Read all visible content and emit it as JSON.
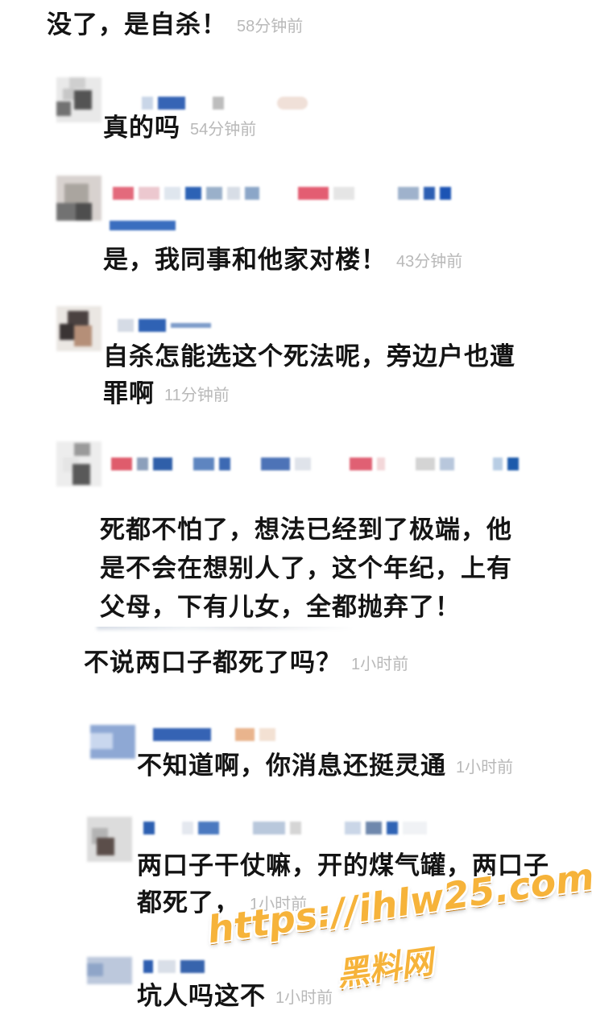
{
  "comments": [
    {
      "text": "没了，是自杀！",
      "time": "58分钟前"
    },
    {
      "text": "真的吗",
      "time": "54分钟前"
    },
    {
      "text": "是，我同事和他家对楼！",
      "time": "43分钟前"
    },
    {
      "text_line1": "自杀怎能选这个死法呢，旁边户也遭",
      "text_line2": "罪啊",
      "time": "11分钟前"
    },
    {
      "line1": "死都不怕了，想法已经到了极端，他",
      "line2": "是不会在想别人了，这个年纪，上有",
      "line3": "父母，下有儿女，全都抛弃了！"
    },
    {
      "text": "不说两口子都死了吗？",
      "time": "1小时前"
    },
    {
      "text": "不知道啊，你消息还挺灵通",
      "time": "1小时前"
    },
    {
      "text_line1": "两口子干仗嘛，开的煤气罐，两口子",
      "text_line2": "都死了，",
      "time": "1小时前"
    },
    {
      "text": "坑人吗这不",
      "time": "1小时前"
    }
  ],
  "watermark": {
    "url": "https://ihlw25.com",
    "name": "黑料网"
  }
}
